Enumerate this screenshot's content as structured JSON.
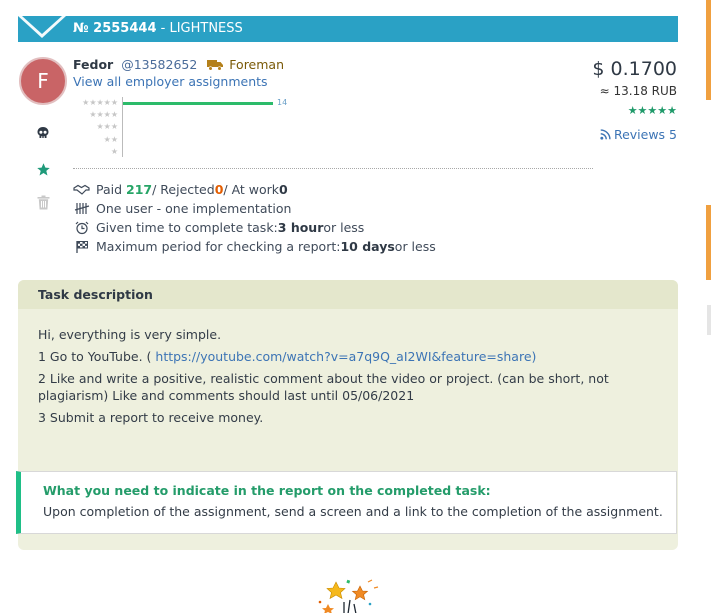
{
  "header": {
    "task_number": "№ 2555444",
    "separator": " - ",
    "category": "LIGHTNESS"
  },
  "employer": {
    "avatar_letter": "F",
    "name": "Fedor",
    "id": "@13582652",
    "role": "Foreman",
    "all_assignments_link": "View all employer assignments",
    "ratings": {
      "rows": [
        {
          "stars": "★★★★★",
          "count": "14",
          "fraction": 1.0
        },
        {
          "stars": "★★★★",
          "count": "",
          "fraction": 0
        },
        {
          "stars": "★★★",
          "count": "",
          "fraction": 0
        },
        {
          "stars": "★★",
          "count": "",
          "fraction": 0
        },
        {
          "stars": "★",
          "count": "",
          "fraction": 0
        }
      ]
    }
  },
  "price": {
    "usd": "$ 0.1700",
    "rub": "≈ 13.18 RUB",
    "stars": "★★★★★",
    "reviews": "Reviews 5"
  },
  "stats": {
    "paid_label": "Paid",
    "paid_value": "217",
    "rejected_label": " / Rejected ",
    "rejected_value": "0",
    "atwork_label": " / At work ",
    "atwork_value": "0",
    "one_user": "One user - one implementation",
    "time_label": "Given time to complete task: ",
    "time_value": "3 hour",
    "time_suffix": " or less",
    "check_label": "Maximum period for checking a report: ",
    "check_value": "10 days",
    "check_suffix": " or less"
  },
  "description": {
    "title": "Task description",
    "line1": "Hi, everything is very simple.",
    "line2_prefix": "1 Go to YouTube. ( ",
    "line2_link": "https://youtube.com/watch?v=a7q9Q_aI2WI&feature=share",
    "line2_suffix": ")",
    "line3": "2 Like and write a positive, realistic comment about the video or project. (can be short, not plagiarism) Like and comments should last until 05/06/2021",
    "line4": "3 Submit a report to receive money."
  },
  "report": {
    "title": "What you need to indicate in the report on the completed task:",
    "text": "Upon completion of the assignment, send a screen and a link to the completion of the assignment."
  },
  "colors": {
    "header_blue": "#2aa1c5",
    "green": "#27a567",
    "orange": "#e35d00",
    "link_blue": "#3c74b5",
    "panel_bg": "#eef0de",
    "report_accent": "#1fbf87"
  }
}
